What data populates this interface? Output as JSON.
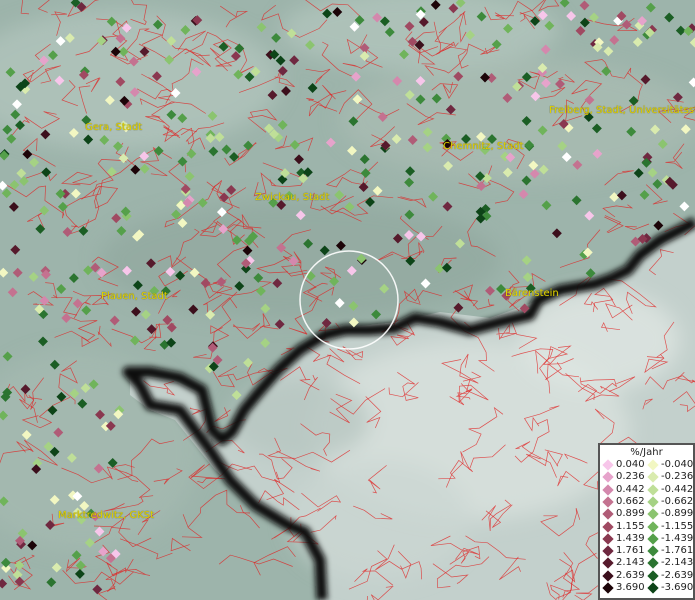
{
  "cities": [
    {
      "id": "gera",
      "label": "Gera, Stadt"
    },
    {
      "id": "chemnitz",
      "label": "Chemnitz, Stadt"
    },
    {
      "id": "freiberg",
      "label": "Freiberg, Stadt, Universitätsst"
    },
    {
      "id": "zwickau",
      "label": "Zwickau, Stadt"
    },
    {
      "id": "plauen",
      "label": "Plauen, Stadt"
    },
    {
      "id": "baerenstein",
      "label": "Bärenstein"
    },
    {
      "id": "marktredwitz",
      "label": "Marktredwitz, GKSt"
    }
  ],
  "legend": {
    "title": "%/Jahr",
    "positive": [
      "0.040",
      "0.236",
      "0.442",
      "0.662",
      "0.899",
      "1.155",
      "1.439",
      "1.761",
      "2.143",
      "2.639",
      "3.690"
    ],
    "negative": [
      "-0.040",
      "-0.236",
      "-0.442",
      "-0.662",
      "-0.899",
      "-1.155",
      "-1.439",
      "-1.761",
      "-2.143",
      "-2.639",
      "-3.690"
    ],
    "positive_colors": [
      "#f7c6ea",
      "#e6a3cb",
      "#d488ad",
      "#c47290",
      "#b05c77",
      "#a04a62",
      "#8a3850",
      "#6f2840",
      "#561a2c",
      "#3c0f1c",
      "#1c0408"
    ],
    "negative_colors": [
      "#f2f7c2",
      "#d9ebae",
      "#bfdf98",
      "#a5d284",
      "#8bc46f",
      "#70b45b",
      "#55a04a",
      "#3d8a3c",
      "#2b7430",
      "#1b5e24",
      "#0d4418"
    ]
  },
  "colors": {
    "border": "#111111",
    "admin_lines": "#e02020",
    "label": "#e3d300",
    "selection_ring": "#ffffff"
  }
}
